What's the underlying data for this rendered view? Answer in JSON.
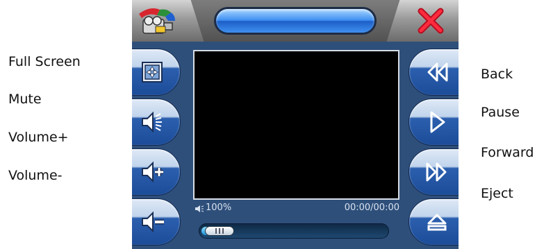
{
  "labels": {
    "full_screen": "Full Screen",
    "mute": "Mute",
    "volume_up": "Volume+",
    "volume_down": "Volume-",
    "back": "Back",
    "pause": "Pause",
    "forward": "Forward",
    "eject": "Eject"
  },
  "status": {
    "volume_level": "100%",
    "time": "00:00/00:00"
  },
  "progress": {
    "fraction": 0.1
  },
  "icons": {
    "app": "video-camera-icon",
    "close": "close-x-icon",
    "full_screen": "full-screen-icon",
    "mute": "mute-icon",
    "volume_up": "volume-up-icon",
    "volume_down": "volume-down-icon",
    "back": "rewind-icon",
    "pause": "play-triangle-icon",
    "forward": "fast-forward-icon",
    "eject": "eject-icon"
  },
  "colors": {
    "panel": "#2e4f7a",
    "button_blue": "#1c4c98",
    "close_red": "#e0142a",
    "title_pill": "#3d8ff2"
  }
}
